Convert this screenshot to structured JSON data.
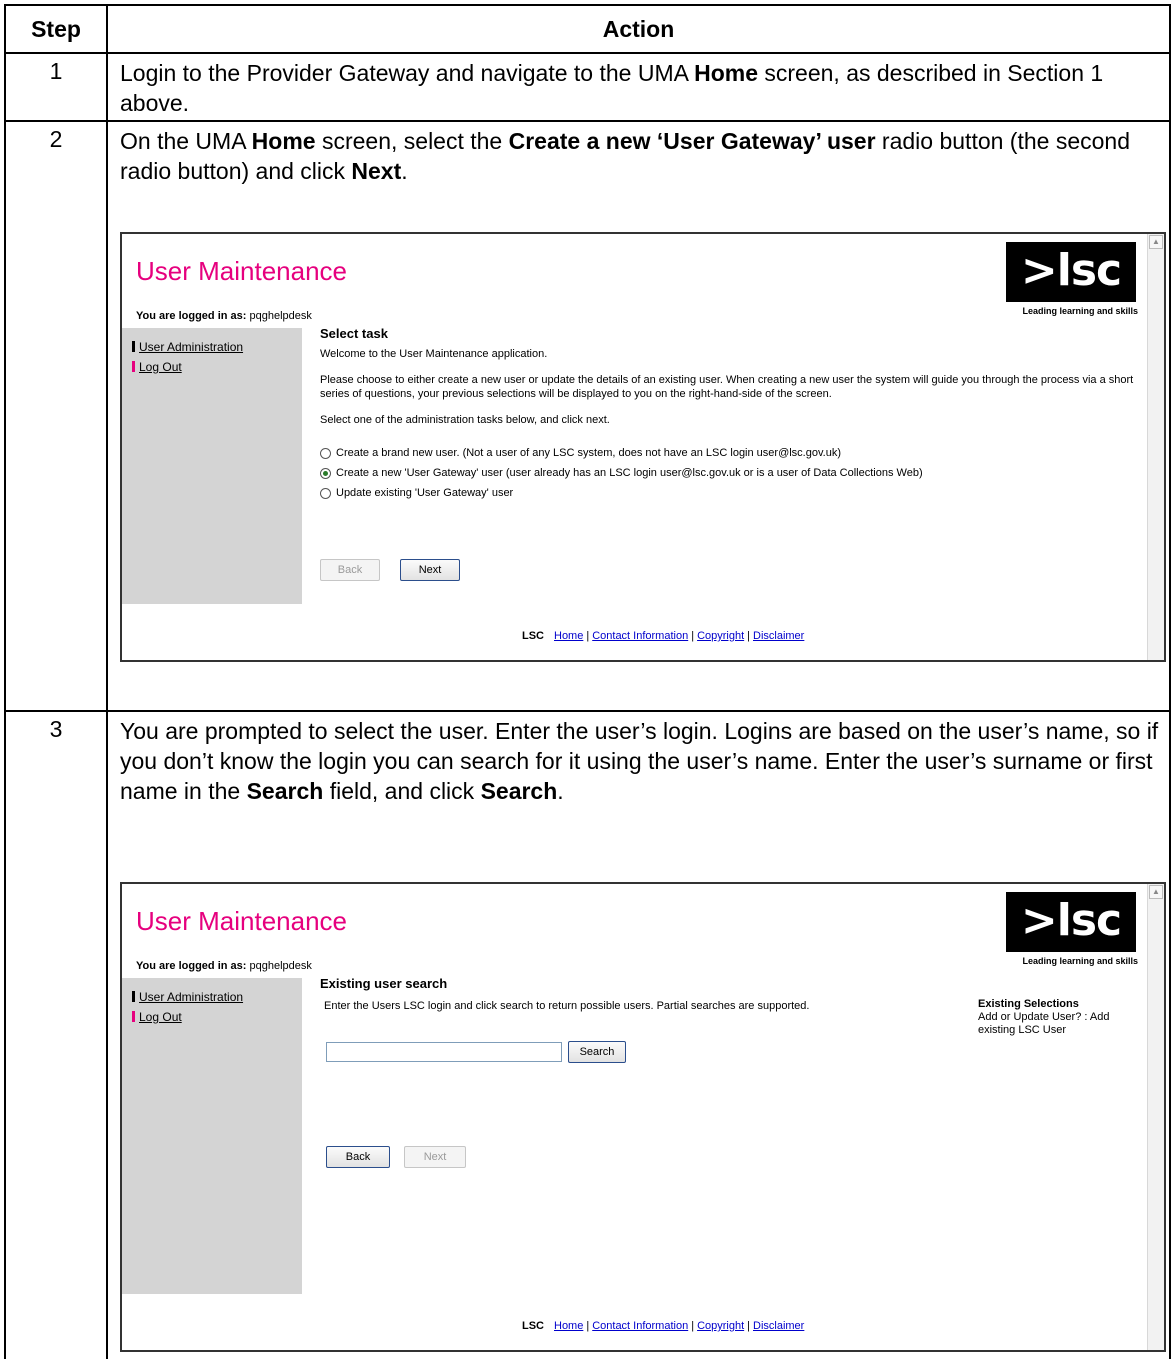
{
  "table": {
    "header_step": "Step",
    "header_action": "Action"
  },
  "steps": [
    {
      "number": "1",
      "text_1": "Login to the Provider Gateway and navigate to the UMA ",
      "bold_1": "Home",
      "text_2": " screen, as described in Section 1 above."
    },
    {
      "number": "2",
      "text_1": "On the UMA ",
      "bold_1": "Home",
      "text_2": " screen, select the ",
      "bold_2": "Create a new ‘User Gateway’ user",
      "text_3": " radio button (the second radio button) and click ",
      "bold_3": "Next",
      "text_4": "."
    },
    {
      "number": "3",
      "text_1": "You are prompted to select the user.  Enter the user’s login.  Logins are based on the user’s name, so if you don’t know the login you can search for it using the user’s name.  Enter the user’s surname or first name in the ",
      "bold_1": "Search",
      "text_2": " field, and click ",
      "bold_2": "Search",
      "text_3": "."
    }
  ],
  "screen1": {
    "app_title": "User Maintenance",
    "logo_text": ">lsc",
    "logo_tagline": "Leading learning and skills",
    "logged_label": "You are logged in as:",
    "logged_user": "pqghelpdesk",
    "nav_user_admin": "User Administration",
    "nav_logout": "Log Out",
    "section_title": "Select task",
    "welcome": "Welcome to the User Maintenance application.",
    "instructions": "Please choose to either create a new user or update the details of an existing user. When creating a new user the system will guide you through the process via a short series of questions, your previous selections will be displayed to you on the right-hand-side of the screen.",
    "select_prompt": "Select one of the administration tasks below, and click next.",
    "option_1": "Create a brand new user. (Not a user of any LSC system, does not have an LSC login user@lsc.gov.uk)",
    "option_2": "Create a new 'User Gateway' user (user already has an LSC login user@lsc.gov.uk or is a user of Data Collections Web)",
    "option_3": "Update existing 'User Gateway' user",
    "back_label": "Back",
    "next_label": "Next",
    "footer_brand": "LSC",
    "footer_home": "Home",
    "footer_contact": "Contact Information",
    "footer_copyright": "Copyright",
    "footer_disclaimer": "Disclaimer",
    "footer_sep": "|"
  },
  "screen2": {
    "app_title": "User Maintenance",
    "logo_text": ">lsc",
    "logo_tagline": "Leading learning and skills",
    "logged_label": "You are logged in as:",
    "logged_user": "pqghelpdesk",
    "nav_user_admin": "User Administration",
    "nav_logout": "Log Out",
    "section_title": "Existing user search",
    "instructions": "Enter the Users LSC login and click search to return possible users. Partial searches are supported.",
    "search_value": "",
    "search_label": "Search",
    "back_label": "Back",
    "next_label": "Next",
    "existing_title": "Existing Selections",
    "existing_text": "Add or Update User? : Add existing LSC User",
    "footer_brand": "LSC",
    "footer_home": "Home",
    "footer_contact": "Contact Information",
    "footer_copyright": "Copyright",
    "footer_disclaimer": "Disclaimer",
    "footer_sep": "|"
  },
  "colors": {
    "title_magenta": "#e6007e",
    "nav_mark_admin": "#000000",
    "nav_mark_logout": "#e6007e",
    "link_blue": "#0000cc"
  }
}
